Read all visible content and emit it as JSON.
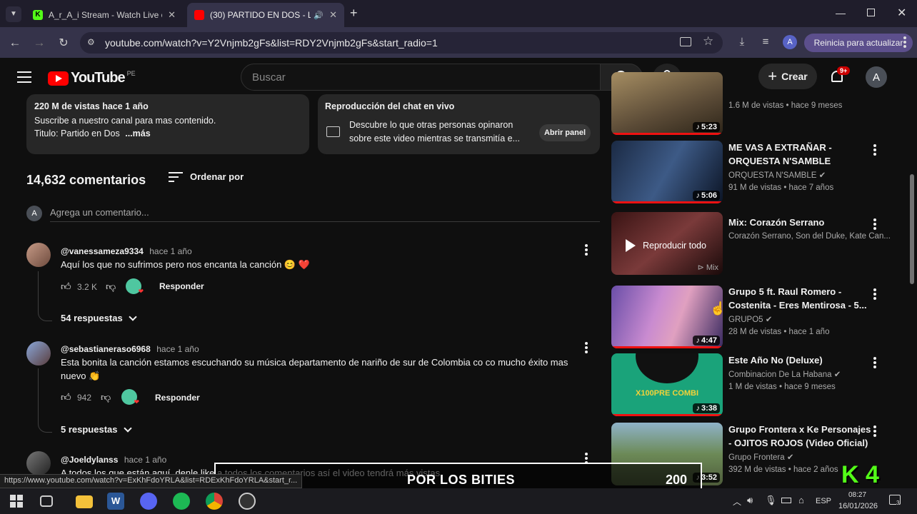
{
  "browser": {
    "tabs": [
      {
        "title": "A_r_A_i Stream - Watch Live on",
        "active": false
      },
      {
        "title": "(30) PARTIDO EN DOS - LA",
        "active": true
      }
    ],
    "url": "youtube.com/watch?v=Y2Vnjmb2gFs&list=RDY2Vnjmb2gFs&start_radio=1",
    "profile_initial": "A",
    "update_label": "Reinicia para actualizar"
  },
  "yt": {
    "logo": "YouTube",
    "country": "PE",
    "search_placeholder": "Buscar",
    "create_label": "Crear",
    "notif_badge": "9+",
    "avatar": "A"
  },
  "description": {
    "stats": "220 M de vistas  hace 1 año",
    "line1": "Suscribe a nuestro canal para mas contenido.",
    "line2": "Titulo: Partido en Dos",
    "more": "...más"
  },
  "chat": {
    "title": "Reproducción del chat en vivo",
    "text1": "Descubre lo que otras personas opinaron",
    "text2": "sobre este video mientras se transmitía e...",
    "button": "Abrir panel"
  },
  "comments": {
    "count": "14,632 comentarios",
    "sort_label": "Ordenar por",
    "add_placeholder": "Agrega un comentario...",
    "add_avatar": "A",
    "items": [
      {
        "user": "@vanessameza9334",
        "time": "hace 1 año",
        "text": "Aquí los que no sufrimos pero nos encanta la canción 😊 ❤️",
        "likes": "3.2 K",
        "reply": "Responder",
        "replies": "54 respuestas"
      },
      {
        "user": "@sebastianeraso6968",
        "time": "hace 1 año",
        "text": "Esta bonita la canción estamos escuchando su música departamento de nariño de sur de Colombia co co mucho éxito mas",
        "text2": "nuevo 👏",
        "likes": "942",
        "reply": "Responder",
        "replies": "5 respuestas"
      },
      {
        "user": "@Joeldylanss",
        "time": "hace 1 año",
        "text": "A todos los que están aquí, denle like a todos los comentarios así el video tendrá más vistas"
      }
    ]
  },
  "sidebar": {
    "videos": [
      {
        "title": "",
        "channel": "",
        "meta": "1.6 M de vistas • hace 9 meses",
        "duration": "5:23"
      },
      {
        "title": "ME VAS A EXTRAÑAR - ORQUESTA N'SAMBLE",
        "channel": "ORQUESTA N'SAMBLE",
        "meta": "91 M de vistas • hace 7 años",
        "duration": "5:06"
      },
      {
        "title": "Mix: Corazón Serrano",
        "channel": "Corazón Serrano, Son del Duke, Kate Can...",
        "meta": "",
        "overlay": "Reproducir todo",
        "tag": "Mix"
      },
      {
        "title": "Grupo 5 ft. Raul Romero - Costenita - Eres Mentirosa - 5...",
        "channel": "GRUPO5",
        "meta": "28 M de vistas • hace 1 año",
        "duration": "4:47"
      },
      {
        "title": "Este Año No (Deluxe)",
        "channel": "Combinacion De La Habana",
        "meta": "1 M de vistas • hace 9 meses",
        "duration": "3:38",
        "thumb_text": "X100PRE COMBI"
      },
      {
        "title": "Grupo Frontera x Ke Personajes - OJITOS ROJOS (Video Oficial)",
        "channel": "Grupo Frontera",
        "meta": "392 M de vistas • hace 2 años",
        "duration": "3:52"
      }
    ]
  },
  "status_url": "https://www.youtube.com/watch?v=ExKhFdoYRLA&list=RDExKhFdoYRLA&start_r...",
  "overlay": {
    "left": "0",
    "center": "POR LOS BITIES",
    "right": "200",
    "logo": "K 4"
  },
  "taskbar": {
    "lang": "ESP",
    "time": "08:27",
    "date": "16/01/2026",
    "notif_count": "3"
  }
}
